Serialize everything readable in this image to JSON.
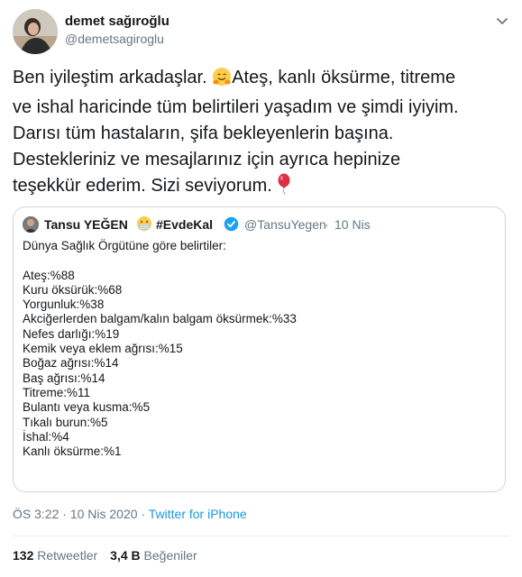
{
  "author": {
    "name": "demet sağıroğlu",
    "handle": "@demetsagiroglu"
  },
  "tweet": {
    "lines": [
      "Ben iyileştim arkadaşlar.",
      "Ateş, kanlı öksürme, titreme",
      "ve ishal haricinde tüm belirtileri yaşadım ve şimdi iyiyim.",
      "Darısı tüm hastaların, şifa bekleyenlerin başına.",
      "Destekleriniz ve mesajlarınız için ayrıca hepinize",
      "teşekkür ederim. Sizi seviyorum."
    ],
    "emojis": [
      "hugging-face-emoji",
      "red-balloon-emoji"
    ]
  },
  "quoted": {
    "name": "Tansu YEĞEN",
    "hashtag": "#EvdeKal",
    "handle": "@TansuYegen",
    "separator": "·",
    "date": "10 Nis",
    "intro": "Dünya Sağlık Örgütüne göre belirtiler:",
    "symptoms": [
      "Ateş:%88",
      "Kuru öksürük:%68",
      "Yorgunluk:%38",
      "Akciğerlerden balgam/kalın balgam öksürmek:%33",
      "Nefes darlığı:%19",
      "Kemik veya eklem ağrısı:%15",
      "Boğaz ağrısı:%14",
      "Baş ağrısı:%14",
      "Titreme:%11",
      "Bulantı veya kusma:%5",
      "Tıkalı burun:%5",
      "İshal:%4",
      "Kanlı öksürme:%1"
    ]
  },
  "meta": {
    "time": "ÖS 3:22",
    "date": "10 Nis 2020",
    "separator": "·",
    "source": "Twitter for iPhone"
  },
  "stats": {
    "retweets_count": "132",
    "retweets_label": "Retweetler",
    "likes_count": "3,4 B",
    "likes_label": "Beğeniler"
  },
  "colors": {
    "text": "#14171a",
    "secondary": "#657786",
    "link": "#1b95e0",
    "border": "#ccd6dd",
    "verified": "#1da1f2"
  }
}
